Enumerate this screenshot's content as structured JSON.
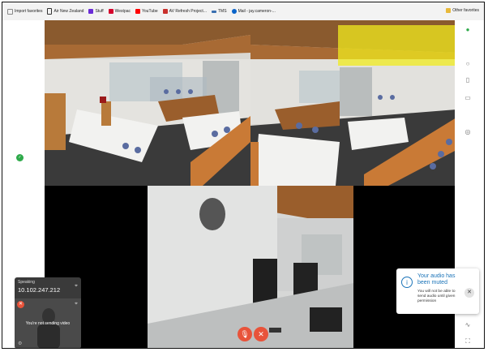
{
  "bookmarks": {
    "items": [
      {
        "label": "Import favorites",
        "color": "#888888"
      },
      {
        "label": "Air New Zealand",
        "color": "#333333"
      },
      {
        "label": "Stuff",
        "color": "#6a2bd6"
      },
      {
        "label": "Westpac",
        "color": "#d5002b"
      },
      {
        "label": "YouTube",
        "color": "#ff0000"
      },
      {
        "label": "AV Refresh Project...",
        "color": "#c9302c"
      },
      {
        "label": "TMS",
        "color": "#3a6fb0"
      },
      {
        "label": "Mail - jay.cameron-...",
        "color": "#0a64c9"
      }
    ],
    "other_label": "Other favorites"
  },
  "speaking": {
    "label": "Speaking",
    "ip": "10.102.247.212"
  },
  "self_view": {
    "text": "You're not sending video"
  },
  "toast": {
    "title": "Your audio has been muted",
    "body": "You will not be able to send audio until given permission"
  },
  "colors": {
    "accent": "#e8533a",
    "toast_blue": "#1a73b8",
    "highlight": "#f0eb1e"
  }
}
